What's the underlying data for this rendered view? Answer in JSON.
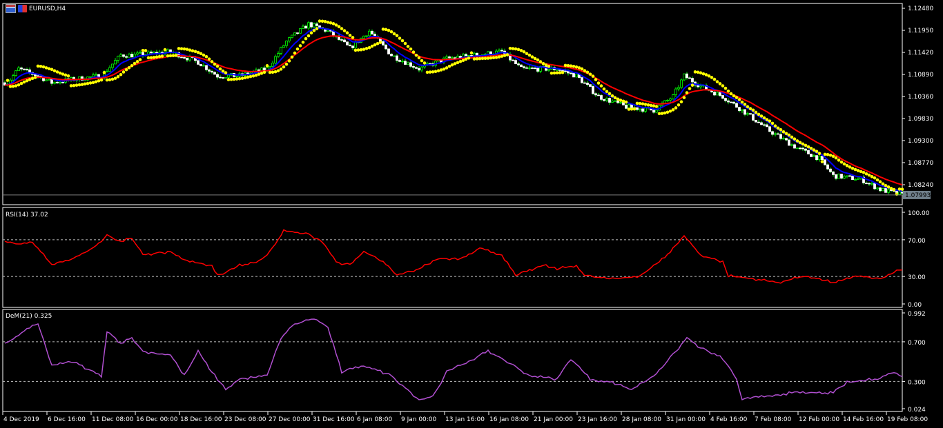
{
  "window": {
    "title": "EURUSD,H4"
  },
  "colors": {
    "bull": "#00ff00",
    "bear": "#ffffff",
    "ma_fast": "#0000ff",
    "ma_slow": "#ff0000",
    "sar": "#ffff00",
    "rsi": "#ff0000",
    "dem": "#b04fd0",
    "grid": "#c0c0c0",
    "price_tag_bg": "#70808c"
  },
  "chart_data": [
    {
      "type": "candlestick",
      "title": "EURUSD,H4",
      "timeframe": "H4",
      "ylim": [
        1.0775,
        1.1255
      ],
      "y_ticks": [
        "1.12480",
        "1.11950",
        "1.11420",
        "1.10890",
        "1.10360",
        "1.09830",
        "1.09300",
        "1.08770",
        "1.08240"
      ],
      "current_price": "1.07993",
      "close_keypoints": {
        "bar": [
          1,
          5,
          12,
          17,
          25,
          35,
          42,
          47,
          60,
          70,
          77,
          85,
          95,
          102,
          110,
          117,
          125,
          132,
          140,
          150,
          160,
          170,
          180,
          187,
          200,
          207,
          215,
          225,
          235,
          242,
          246,
          252,
          260,
          267,
          277,
          287,
          295,
          300,
          310,
          317,
          325
        ],
        "price": [
          1.10692,
          1.11023,
          1.10857,
          1.10692,
          1.10774,
          1.10857,
          1.11354,
          1.11354,
          1.11437,
          1.11188,
          1.10857,
          1.10857,
          1.11023,
          1.11685,
          1.12099,
          1.11933,
          1.1152,
          1.11933,
          1.11354,
          1.11023,
          1.11271,
          1.11354,
          1.11437,
          1.11023,
          1.11023,
          1.10857,
          1.1036,
          1.10112,
          1.10029,
          1.1036,
          1.10857,
          1.10609,
          1.1036,
          1.10029,
          1.09532,
          1.09118,
          1.0887,
          1.08456,
          1.08373,
          1.08125,
          1.07993
        ]
      },
      "x_ticks": [
        "4 Dec 2019",
        "6 Dec 16:00",
        "11 Dec 08:00",
        "16 Dec 00:00",
        "18 Dec 16:00",
        "23 Dec 08:00",
        "27 Dec 00:00",
        "31 Dec 16:00",
        "6 Jan 08:00",
        "9 Jan 00:00",
        "13 Jan 16:00",
        "16 Jan 08:00",
        "21 Jan 00:00",
        "23 Jan 16:00",
        "28 Jan 08:00",
        "31 Jan 00:00",
        "4 Feb 16:00",
        "7 Feb 08:00",
        "12 Feb 00:00",
        "14 Feb 16:00",
        "19 Feb 08:00"
      ],
      "series": [
        {
          "name": "MA fast",
          "color": "blue"
        },
        {
          "name": "MA slow",
          "color": "red"
        },
        {
          "name": "Parabolic SAR",
          "color": "yellow"
        }
      ]
    },
    {
      "type": "line",
      "label": "RSI(14) 37.02",
      "ylim": [
        0,
        100
      ],
      "y_ticks": [
        "100.00",
        "70.00",
        "30.00",
        "0.00"
      ],
      "levels": [
        70,
        30
      ],
      "keypoints": {
        "bar": [
          1,
          5,
          10,
          17,
          25,
          32,
          37,
          42,
          46,
          50,
          60,
          67,
          75,
          77,
          85,
          92,
          97,
          101,
          110,
          115,
          120,
          125,
          130,
          137,
          142,
          150,
          157,
          165,
          172,
          180,
          185,
          195,
          200,
          207,
          210,
          220,
          230,
          237,
          241,
          246,
          252,
          260,
          262,
          272,
          280,
          290,
          300,
          310,
          317,
          325
        ],
        "value": [
          68.4,
          64.7,
          68.4,
          42.1,
          49.6,
          60.9,
          74.4,
          68.4,
          72.2,
          53.4,
          57.1,
          45.9,
          42.1,
          30.8,
          42.1,
          45.9,
          60.9,
          79.7,
          75.9,
          68.4,
          45.9,
          42.1,
          57.1,
          45.9,
          30.8,
          38.3,
          49.6,
          49.6,
          60.9,
          53.4,
          30.8,
          42.1,
          38.3,
          42.1,
          30.8,
          27.1,
          30.8,
          45.9,
          57.1,
          74.4,
          53.4,
          45.9,
          30.8,
          27.1,
          23.3,
          30.8,
          23.3,
          30.8,
          27.1,
          38.3
        ]
      },
      "current": 37.02
    },
    {
      "type": "line",
      "label": "DeM(21) 0.325",
      "ylim": [
        0.024,
        0.992
      ],
      "y_ticks": [
        "0.992",
        "0.700",
        "0.300",
        "0.024"
      ],
      "levels": [
        0.7,
        0.3
      ],
      "keypoints": {
        "bar": [
          1,
          7,
          12,
          17,
          25,
          32,
          35,
          37,
          42,
          46,
          50,
          60,
          65,
          70,
          75,
          80,
          85,
          95,
          100,
          105,
          112,
          117,
          122,
          130,
          140,
          150,
          155,
          160,
          170,
          175,
          180,
          190,
          200,
          205,
          212,
          220,
          227,
          235,
          242,
          247,
          252,
          260,
          265,
          267,
          275,
          285,
          300,
          305,
          315,
          322,
          326
        ],
        "value": [
          0.686,
          0.811,
          0.881,
          0.463,
          0.498,
          0.393,
          0.358,
          0.811,
          0.686,
          0.741,
          0.602,
          0.567,
          0.358,
          0.602,
          0.393,
          0.219,
          0.323,
          0.358,
          0.741,
          0.881,
          0.936,
          0.846,
          0.393,
          0.463,
          0.358,
          0.115,
          0.149,
          0.393,
          0.532,
          0.602,
          0.532,
          0.358,
          0.323,
          0.532,
          0.323,
          0.289,
          0.219,
          0.358,
          0.567,
          0.741,
          0.637,
          0.532,
          0.323,
          0.115,
          0.149,
          0.184,
          0.184,
          0.289,
          0.323,
          0.393,
          0.325
        ]
      },
      "current": 0.325
    }
  ]
}
